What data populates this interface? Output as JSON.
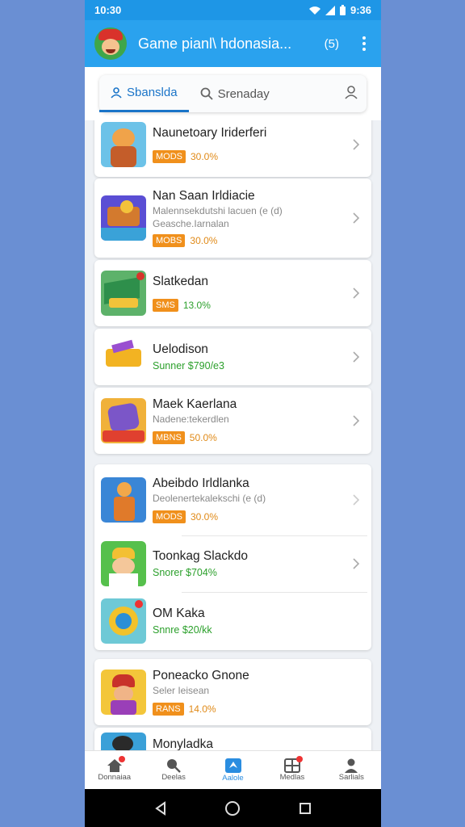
{
  "status": {
    "time": "10:30",
    "right_time": "9:36"
  },
  "appbar": {
    "title": "Game pianl\\ hdonasia...",
    "count": "(5)"
  },
  "tabs": [
    {
      "label": "Sbanslda"
    },
    {
      "label": "Srenaday"
    }
  ],
  "items": [
    {
      "name": "Naunetoary Iriderferi",
      "badge": "MODS",
      "pct": "30.0%"
    },
    {
      "name": "Nan Saan Irldiacie",
      "sub1": "Malennsekdutshi lacuen (e (d)",
      "sub2": "Geasche.Iarnalan",
      "badge": "MOBS",
      "pct": "30.0%"
    },
    {
      "name": "Slatkedan",
      "badge": "SMS",
      "pct": "13.0%"
    },
    {
      "name": "Uelodison",
      "green": "Sunner $790/e3"
    },
    {
      "name": "Maek Kaerlana",
      "sub1": "Nadene:tekerdlen",
      "badge": "MBNS",
      "pct": "50.0%"
    },
    {
      "name": "Abeibdo Irldlanka",
      "sub1": "Deolenertekalekschi (e (d)",
      "badge": "MODS",
      "pct": "30.0%"
    },
    {
      "name": "Toonkag Slackdo",
      "green": "Snorer $704%"
    },
    {
      "name": "OM Kaka",
      "green": "Snnre $20/kk"
    },
    {
      "name": "Poneacko Gnone",
      "sub1": "Seler Ieisean",
      "badge": "RANS",
      "pct": "14.0%"
    },
    {
      "name": "Monyladka"
    }
  ],
  "nav": [
    {
      "label": "Donnaiaa"
    },
    {
      "label": "Deelas"
    },
    {
      "label": "Aalole"
    },
    {
      "label": "Medlas"
    },
    {
      "label": "Sarlials"
    }
  ],
  "colors": {
    "accent": "#2aa2ee",
    "badge": "#f0901c",
    "green": "#2ca02c"
  }
}
